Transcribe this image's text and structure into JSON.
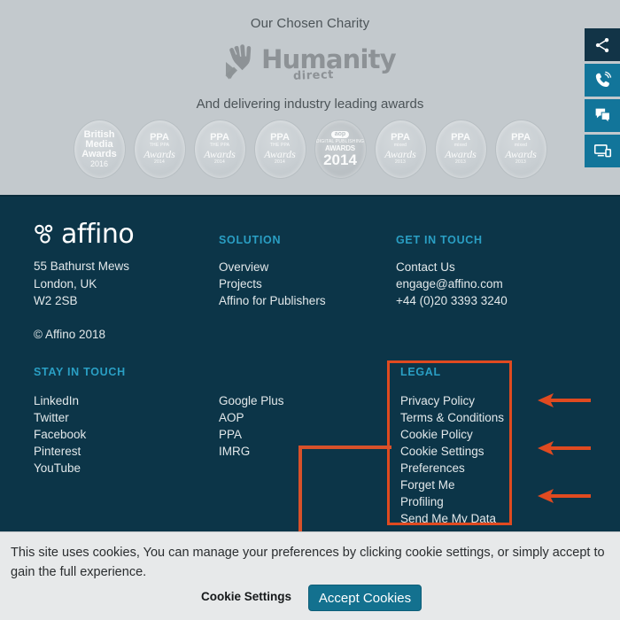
{
  "top": {
    "charity_label": "Our Chosen Charity",
    "charity_logo_name": "Humanity",
    "charity_logo_sub": "direct",
    "awards_label": "And delivering industry leading awards",
    "badges": [
      {
        "type": "bma",
        "l1": "British",
        "l2": "Media",
        "l3": "Awards",
        "year": "2016"
      },
      {
        "type": "ppa",
        "l1": "PPA",
        "l2": "THE PPA",
        "l3": "Awards",
        "year": "2014"
      },
      {
        "type": "ppa",
        "l1": "PPA",
        "l2": "THE PPA",
        "l3": "Awards",
        "year": "2014"
      },
      {
        "type": "ppa",
        "l1": "PPA",
        "l2": "THE PPA",
        "l3": "Awards",
        "year": "2014"
      },
      {
        "type": "oop",
        "l1": "aop",
        "l2": "DIGITAL PUBLISHING",
        "l3": "AWARDS",
        "year": "2014"
      },
      {
        "type": "ppa",
        "l1": "PPA",
        "l2": "mixed",
        "l3": "Awards",
        "year": "2013"
      },
      {
        "type": "ppa",
        "l1": "PPA",
        "l2": "mixed",
        "l3": "Awards",
        "year": "2013"
      },
      {
        "type": "ppa",
        "l1": "PPA",
        "l2": "mixed",
        "l3": "Awards",
        "year": "2013"
      }
    ]
  },
  "side_rail": [
    {
      "icon": "share-icon",
      "label": "Share"
    },
    {
      "icon": "phone-icon",
      "label": "Call"
    },
    {
      "icon": "chat-icon",
      "label": "Chat"
    },
    {
      "icon": "devices-icon",
      "label": "Demo"
    }
  ],
  "footer": {
    "brand": "affino",
    "address_line1": "55 Bathurst Mews",
    "address_line2": "London, UK",
    "address_line3": "W2 2SB",
    "copyright": "© Affino 2018",
    "solution": {
      "heading": "SOLUTION",
      "links": [
        "Overview",
        "Projects",
        "Affino for Publishers"
      ]
    },
    "get_in_touch": {
      "heading": "GET IN TOUCH",
      "links": [
        "Contact Us",
        "engage@affino.com",
        "+44 (0)20 3393 3240"
      ]
    },
    "stay_in_touch": {
      "heading": "STAY IN TOUCH",
      "links": [
        "LinkedIn",
        "Twitter",
        "Facebook",
        "Pinterest",
        "YouTube"
      ]
    },
    "organisations": {
      "links": [
        "Google Plus",
        "AOP",
        "PPA",
        "IMRG"
      ]
    },
    "legal": {
      "heading": "LEGAL",
      "links": [
        "Privacy Policy",
        "Terms & Conditions",
        "Cookie Policy",
        "Cookie Settings",
        "Preferences",
        "Forget Me",
        "Profiling",
        "Send Me My Data"
      ]
    }
  },
  "cookie_banner": {
    "message": "This site uses cookies, You can manage your preferences by clicking cookie settings, or simply accept to gain the full experience.",
    "settings_link": "Cookie Settings",
    "accept_label": "Accept Cookies"
  },
  "annotation": {
    "color": "#e04a20",
    "arrow_count": 3,
    "highlight_target": "LEGAL"
  }
}
